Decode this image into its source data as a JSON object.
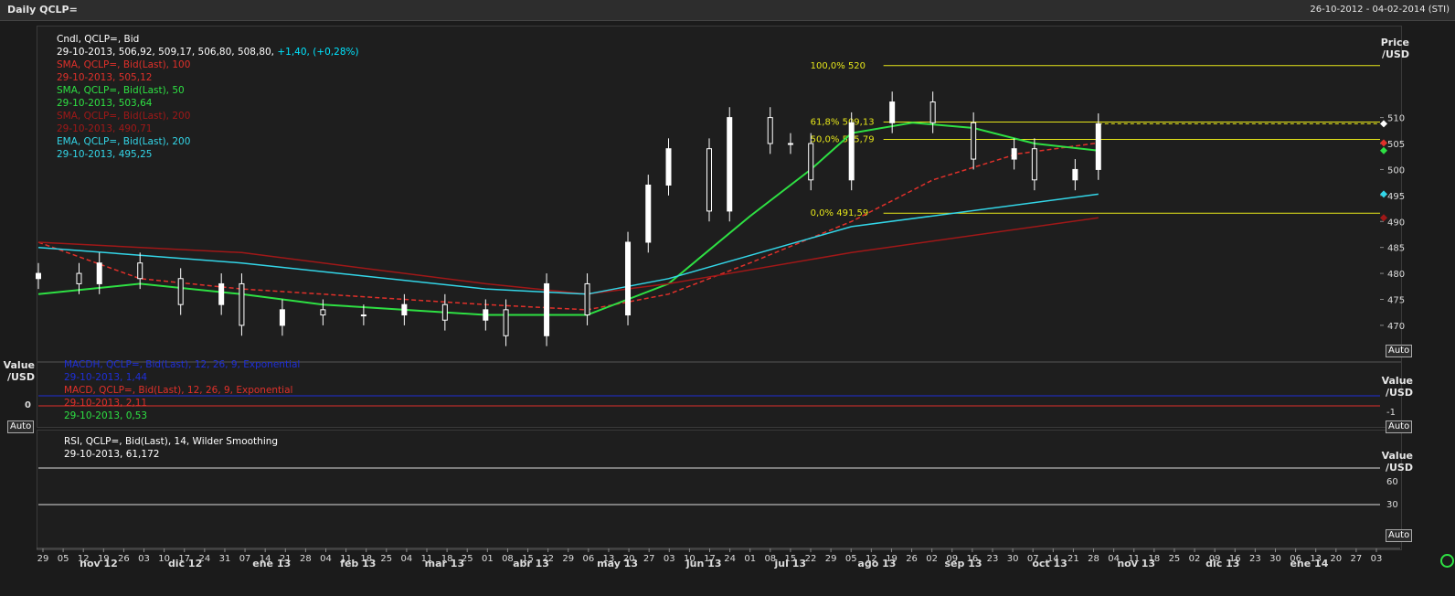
{
  "window": {
    "title": "Daily QCLP=",
    "date_range": "26-10-2012 - 04-02-2014 (STI)"
  },
  "price_legend": [
    {
      "text": "Cndl, QCLP=, Bid",
      "color": "#ffffff"
    },
    {
      "text": "29-10-2013, 506,92, 509,17, 506,80, 508,80,",
      "color": "#ffffff",
      "extra": " +1,40, (+0,28%)",
      "extra_color": "#00e5ff"
    },
    {
      "text": "SMA, QCLP=, Bid(Last),  100",
      "color": "#e0302a"
    },
    {
      "text": "29-10-2013, 505,12",
      "color": "#e0302a"
    },
    {
      "text": "SMA, QCLP=, Bid(Last),  50",
      "color": "#2ee043"
    },
    {
      "text": "29-10-2013, 503,64",
      "color": "#2ee043"
    },
    {
      "text": "SMA, QCLP=, Bid(Last),  200",
      "color": "#a01818"
    },
    {
      "text": "29-10-2013, 490,71",
      "color": "#a01818"
    },
    {
      "text": "EMA, QCLP=, Bid(Last),  200",
      "color": "#33d6e8"
    },
    {
      "text": "29-10-2013, 495,25",
      "color": "#33d6e8"
    }
  ],
  "macd_legend": [
    {
      "text": "MACDH, QCLP=, Bid(Last),  12, 26, 9, Exponential",
      "color": "#1e2fd8"
    },
    {
      "text": "29-10-2013, 1,44",
      "color": "#1e2fd8"
    },
    {
      "text": "MACD, QCLP=, Bid(Last),  12, 26, 9, Exponential",
      "color": "#e0302a"
    },
    {
      "text": "29-10-2013, 2,11",
      "color": "#e0302a"
    },
    {
      "text": "29-10-2013, 0,53",
      "color": "#2ee043"
    }
  ],
  "rsi_legend": [
    {
      "text": "RSI, QCLP=, Bid(Last),  14, Wilder Smoothing",
      "color": "#ffffff"
    },
    {
      "text": "29-10-2013, 61,172",
      "color": "#ffffff"
    }
  ],
  "axis_titles": {
    "price": [
      "Price",
      "/USD"
    ],
    "macd_left": [
      "Value",
      "/USD"
    ],
    "macd_right": [
      "Value",
      "/USD"
    ],
    "rsi_right": [
      "Value",
      "/USD"
    ]
  },
  "auto_label": "Auto",
  "macd_zero_label": "0",
  "macd_tick": "-1",
  "rsi_ticks": [
    "60",
    "30"
  ],
  "fib_labels": [
    "100,0% 520",
    "61,8%  509,13",
    "50,0%  505,79",
    "0,0%     491,59"
  ],
  "colors": {
    "background": "#1e1e1e",
    "candle": "#ffffff",
    "sma100": "#e0302a",
    "sma50": "#2ee043",
    "sma200": "#a01818",
    "ema200": "#33d6e8",
    "macdh": "#1e2fd8",
    "fib": "#e6e61a"
  },
  "x_ticks": [
    "29",
    "05",
    "12",
    "19",
    "26",
    "03",
    "10",
    "17",
    "24",
    "31",
    "07",
    "14",
    "21",
    "28",
    "04",
    "11",
    "18",
    "25",
    "04",
    "11",
    "18",
    "25",
    "01",
    "08",
    "15",
    "22",
    "29",
    "06",
    "13",
    "20",
    "27",
    "03",
    "10",
    "17",
    "24",
    "01",
    "08",
    "15",
    "22",
    "29",
    "05",
    "12",
    "19",
    "26",
    "02",
    "09",
    "16",
    "23",
    "30",
    "07",
    "14",
    "21",
    "28",
    "04",
    "11",
    "18",
    "25",
    "02",
    "09",
    "16",
    "23",
    "30",
    "06",
    "13",
    "20",
    "27",
    "03"
  ],
  "month_labels": [
    "nov 12",
    "dic 12",
    "ene 13",
    "feb 13",
    "mar 13",
    "abr 13",
    "may 13",
    "jun 13",
    "jul 13",
    "ago 13",
    "sep 13",
    "oct 13",
    "nov 13",
    "dic 13",
    "ene 14"
  ],
  "chart_data": {
    "type": "line",
    "title": "Daily QCLP=",
    "ylabel": "Price /USD",
    "ylim": [
      464,
      527
    ],
    "yticks": [
      470,
      475,
      480,
      485,
      490,
      495,
      500,
      505,
      510
    ],
    "series": [
      {
        "name": "Cndl, QCLP=, Bid",
        "type": "candlestick",
        "x": [
          "2012-10-29",
          "2012-11-12",
          "2012-11-19",
          "2012-12-03",
          "2012-12-17",
          "2012-12-31",
          "2013-01-07",
          "2013-01-21",
          "2013-02-04",
          "2013-02-18",
          "2013-03-04",
          "2013-03-18",
          "2013-04-01",
          "2013-04-08",
          "2013-04-22",
          "2013-05-06",
          "2013-05-20",
          "2013-05-27",
          "2013-06-03",
          "2013-06-17",
          "2013-06-24",
          "2013-07-08",
          "2013-07-15",
          "2013-07-22",
          "2013-08-05",
          "2013-08-19",
          "2013-09-02",
          "2013-09-16",
          "2013-09-30",
          "2013-10-07",
          "2013-10-21",
          "2013-10-29"
        ],
        "close": [
          480,
          478,
          482,
          479,
          474,
          478,
          470,
          473,
          472,
          472,
          474,
          471,
          473,
          468,
          478,
          472,
          486,
          497,
          504,
          492,
          510,
          505,
          505,
          498,
          509,
          513,
          509,
          502,
          504,
          498,
          500,
          508.8
        ]
      },
      {
        "name": "SMA, QCLP=, Bid(Last),  100",
        "x": [
          "2012-10-29",
          "2012-12-03",
          "2013-01-07",
          "2013-02-04",
          "2013-03-04",
          "2013-04-01",
          "2013-05-06",
          "2013-06-03",
          "2013-07-01",
          "2013-08-05",
          "2013-09-02",
          "2013-10-01",
          "2013-10-29"
        ],
        "values": [
          486,
          479,
          477,
          476,
          475,
          474,
          473,
          476,
          482,
          490,
          498,
          503,
          505.12
        ]
      },
      {
        "name": "SMA, QCLP=, Bid(Last),  50",
        "x": [
          "2012-10-29",
          "2012-12-03",
          "2013-01-07",
          "2013-02-04",
          "2013-03-04",
          "2013-04-01",
          "2013-05-06",
          "2013-06-03",
          "2013-07-01",
          "2013-07-22",
          "2013-08-05",
          "2013-08-26",
          "2013-09-16",
          "2013-10-07",
          "2013-10-29"
        ],
        "values": [
          476,
          478,
          476,
          474,
          473,
          472,
          472,
          478,
          491,
          500,
          507,
          509,
          508,
          505,
          503.64
        ]
      },
      {
        "name": "SMA, QCLP=, Bid(Last),  200",
        "x": [
          "2012-10-29",
          "2013-01-07",
          "2013-04-01",
          "2013-05-06",
          "2013-06-03",
          "2013-08-05",
          "2013-10-29"
        ],
        "values": [
          486,
          484,
          478,
          476,
          478,
          484,
          490.71
        ]
      },
      {
        "name": "EMA, QCLP=, Bid(Last),  200",
        "x": [
          "2012-10-29",
          "2013-01-07",
          "2013-04-01",
          "2013-05-06",
          "2013-06-03",
          "2013-08-05",
          "2013-10-29"
        ],
        "values": [
          485,
          482,
          477,
          476,
          479,
          489,
          495.25
        ]
      }
    ],
    "fibonacci": [
      {
        "label": "100,0%",
        "value": 520
      },
      {
        "label": "61,8%",
        "value": 509.13
      },
      {
        "label": "50,0%",
        "value": 505.79
      },
      {
        "label": "0,0%",
        "value": 491.59
      }
    ]
  }
}
